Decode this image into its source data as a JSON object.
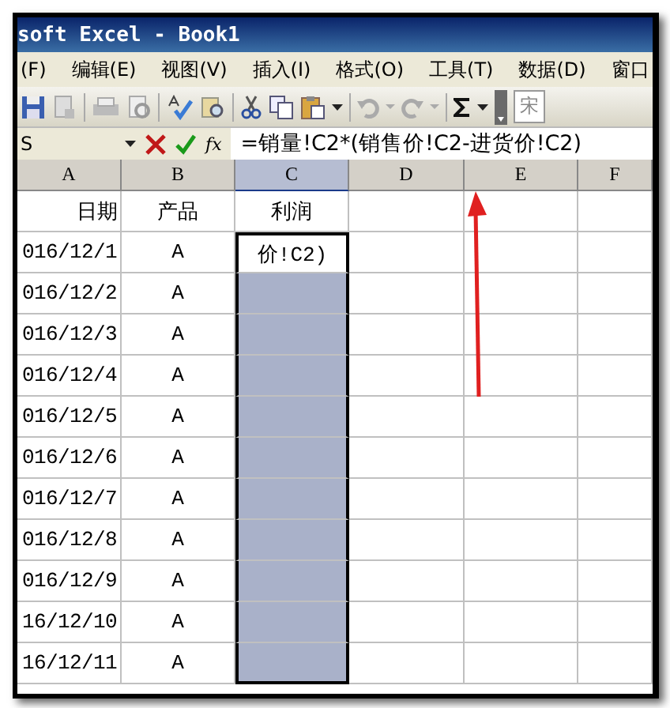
{
  "window": {
    "title": "soft Excel - Book1"
  },
  "menu": [
    {
      "label": "(F)"
    },
    {
      "label": "编辑(E)"
    },
    {
      "label": "视图(V)"
    },
    {
      "label": "插入(I)"
    },
    {
      "label": "格式(O)"
    },
    {
      "label": "工具(T)"
    },
    {
      "label": "数据(D)"
    },
    {
      "label": "窗口"
    }
  ],
  "toolbar": {
    "font_box": "宋"
  },
  "formula_bar": {
    "name_box": "S",
    "function_button": "fx",
    "formula": "=销量!C2*(销售价!C2-进货价!C2)"
  },
  "columns": [
    {
      "label": "A",
      "selected": false
    },
    {
      "label": "B",
      "selected": false
    },
    {
      "label": "C",
      "selected": true
    },
    {
      "label": "D",
      "selected": false
    },
    {
      "label": "E",
      "selected": false
    },
    {
      "label": "F",
      "selected": false
    }
  ],
  "rows": [
    {
      "date": "日期",
      "product": "产品",
      "profit": "利润",
      "selected": false,
      "active": false
    },
    {
      "date": "016/12/1",
      "product": "A",
      "profit": "价!C2)",
      "selected": true,
      "active": true
    },
    {
      "date": "016/12/2",
      "product": "A",
      "selected": true,
      "active": false
    },
    {
      "date": "016/12/3",
      "product": "A",
      "selected": true,
      "active": false
    },
    {
      "date": "016/12/4",
      "product": "A",
      "selected": true,
      "active": false
    },
    {
      "date": "016/12/5",
      "product": "A",
      "selected": true,
      "active": false
    },
    {
      "date": "016/12/6",
      "product": "A",
      "selected": true,
      "active": false
    },
    {
      "date": "016/12/7",
      "product": "A",
      "selected": true,
      "active": false
    },
    {
      "date": "016/12/8",
      "product": "A",
      "selected": true,
      "active": false
    },
    {
      "date": "016/12/9",
      "product": "A",
      "selected": true,
      "active": false
    },
    {
      "date": "16/12/10",
      "product": "A",
      "selected": true,
      "active": false
    },
    {
      "date": "16/12/11",
      "product": "A",
      "selected": true,
      "active": false
    }
  ]
}
